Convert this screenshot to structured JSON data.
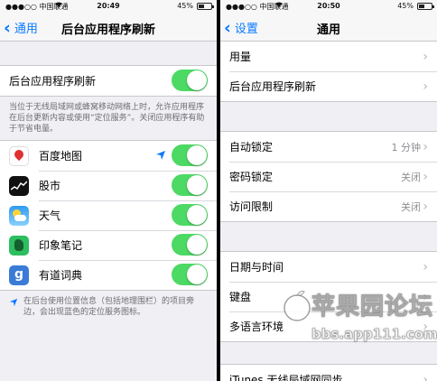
{
  "colors": {
    "accent": "#0a7aff",
    "toggle_on": "#4cd964",
    "background": "#efeff4"
  },
  "left": {
    "status": {
      "carrier": "●●●○○ 中国联通",
      "wifi_icon": "wifi-icon",
      "time": "20:49",
      "battery": "45%"
    },
    "nav": {
      "back_label": "通用",
      "title": "后台应用程序刷新"
    },
    "master_toggle": {
      "label": "后台应用程序刷新",
      "on": true
    },
    "description": "当位于无线局域网或蜂窝移动网络上时，允许应用程序在后台更新内容或使用“定位服务”。关闭应用程序有助于节省电量。",
    "apps": [
      {
        "name": "百度地图",
        "icon": "baidu-map-icon",
        "location": true,
        "on": true
      },
      {
        "name": "股市",
        "icon": "stocks-icon",
        "location": false,
        "on": true
      },
      {
        "name": "天气",
        "icon": "weather-icon",
        "location": false,
        "on": true
      },
      {
        "name": "印象笔记",
        "icon": "evernote-icon",
        "location": false,
        "on": true
      },
      {
        "name": "有道词典",
        "icon": "youdao-icon",
        "location": false,
        "on": true
      }
    ],
    "location_note": "在后台使用位置信息（包括地理围栏）的项目旁边，会出现蓝色的定位服务图标。"
  },
  "right": {
    "status": {
      "carrier": "●●●○○ 中国联通",
      "wifi_icon": "wifi-icon",
      "time": "20:50",
      "battery": "45%"
    },
    "nav": {
      "back_label": "设置",
      "title": "通用"
    },
    "groups": [
      [
        {
          "label": "用量",
          "value": ""
        },
        {
          "label": "后台应用程序刷新",
          "value": ""
        }
      ],
      [
        {
          "label": "自动锁定",
          "value": "1 分钟"
        },
        {
          "label": "密码锁定",
          "value": "关闭"
        },
        {
          "label": "访问限制",
          "value": "关闭"
        }
      ],
      [
        {
          "label": "日期与时间",
          "value": ""
        },
        {
          "label": "键盘",
          "value": ""
        },
        {
          "label": "多语言环境",
          "value": ""
        }
      ],
      [
        {
          "label": "iTunes 无线局域网同步",
          "value": ""
        }
      ]
    ]
  },
  "watermark": {
    "title": "苹果园论坛",
    "url": "bbs.app111.com"
  }
}
